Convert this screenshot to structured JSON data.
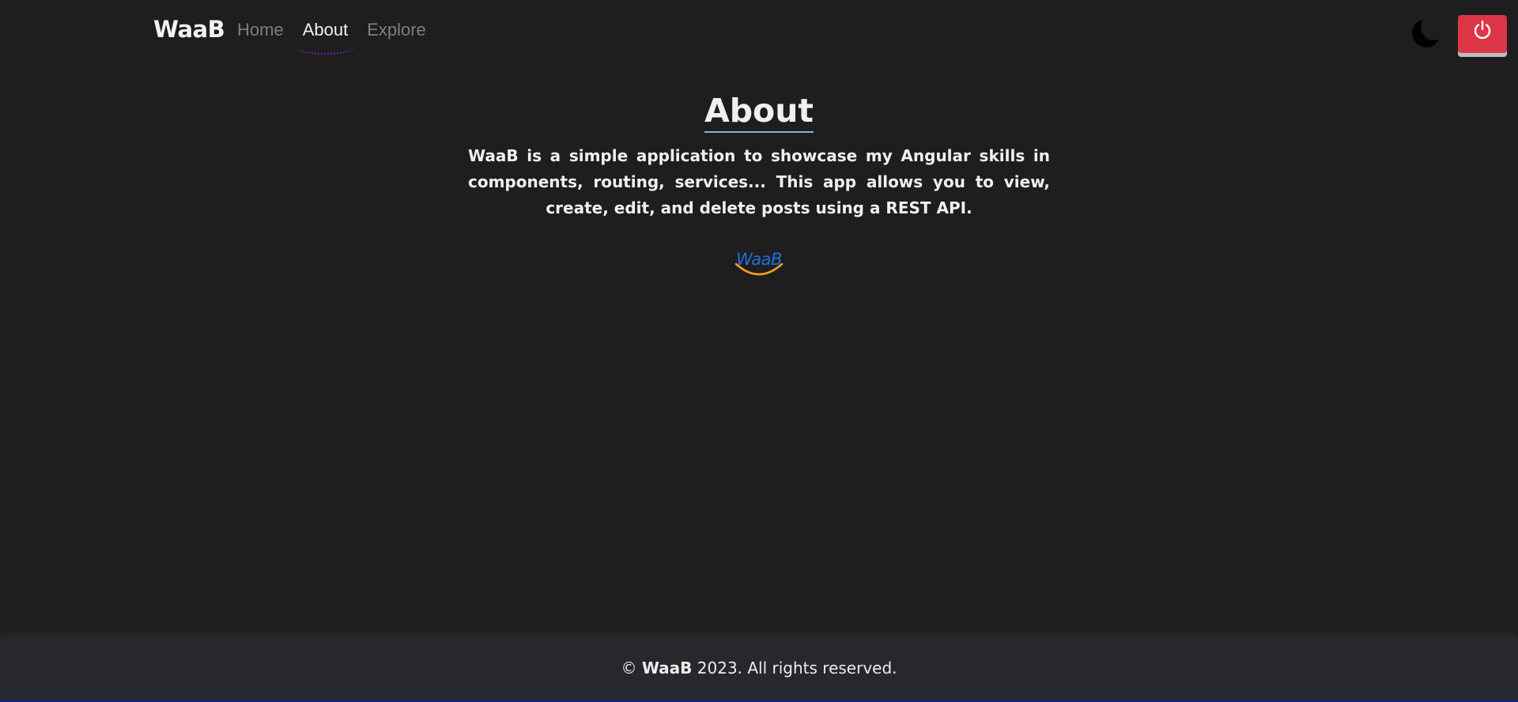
{
  "navbar": {
    "brand": "WaaB",
    "links": [
      {
        "label": "Home",
        "active": false
      },
      {
        "label": "About",
        "active": true
      },
      {
        "label": "Explore",
        "active": false
      }
    ],
    "theme_toggle_icon": "moon-icon",
    "power_button_icon": "power-icon",
    "power_button_color": "#dc3545"
  },
  "main": {
    "title": "About",
    "description": "WaaB is a simple application to showcase my Angular skills in components, routing, services... This app allows you to view, create, edit, and delete posts using a REST API.",
    "logo_text": "WaaB",
    "logo_color": "#1f6fe0",
    "logo_smile_color": "#f0a020"
  },
  "footer": {
    "copyright_symbol": "©",
    "brand": "WaaB",
    "text": "2023. All rights reserved."
  }
}
